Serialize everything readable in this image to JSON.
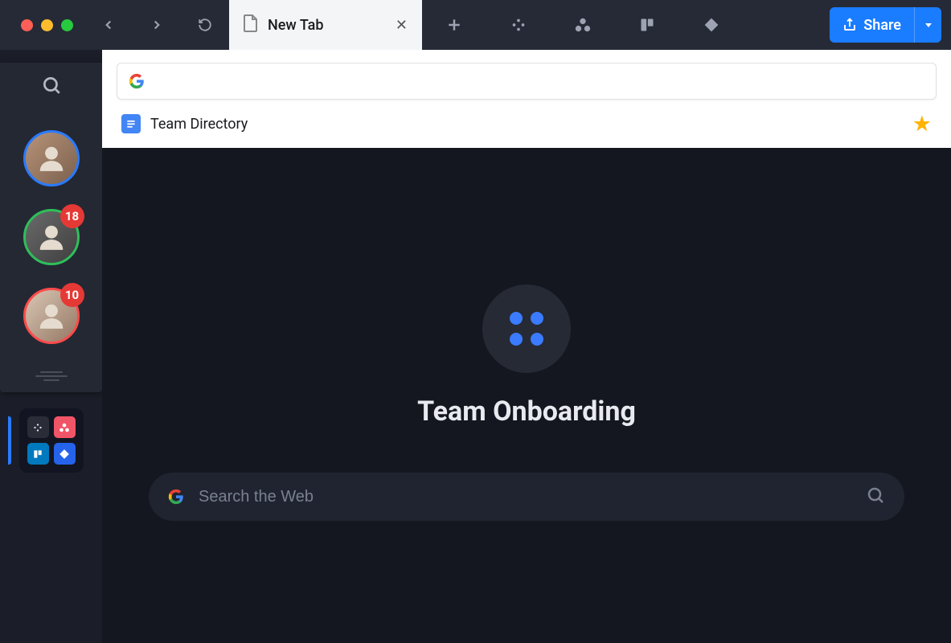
{
  "tab": {
    "title": "New Tab"
  },
  "share": {
    "label": "Share"
  },
  "sidebar": {
    "avatars": [
      {
        "badge": null
      },
      {
        "badge": "18"
      },
      {
        "badge": "10"
      }
    ]
  },
  "bookmark": {
    "label": "Team Directory"
  },
  "workspace": {
    "title": "Team Onboarding",
    "search_placeholder": "Search the Web"
  }
}
